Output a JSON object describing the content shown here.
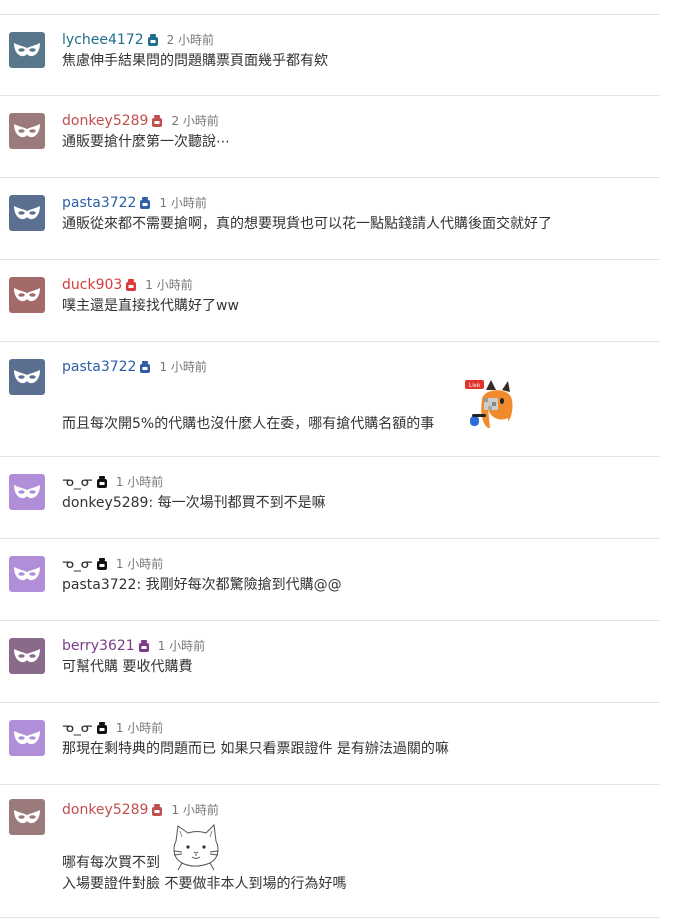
{
  "comments": [
    {
      "username": "lychee4172",
      "user_color": "#1f6f8b",
      "avatar_color": "#58778a",
      "time": "2 小時前",
      "lines": [
        "焦慮伸手結果問的問題購票頁面幾乎都有欸"
      ]
    },
    {
      "username": "donkey5289",
      "user_color": "#c0504d",
      "avatar_color": "#9a7a7a",
      "time": "2 小時前",
      "lines": [
        "通販要搶什麼第一次聽說⋯"
      ]
    },
    {
      "username": "pasta3722",
      "user_color": "#2e5fa6",
      "avatar_color": "#5b7091",
      "time": "1 小時前",
      "lines": [
        "通販從來都不需要搶啊，真的想要現貨也可以花一點點錢請人代購後面交就好了"
      ]
    },
    {
      "username": "duck903",
      "user_color": "#d93a3a",
      "avatar_color": "#a36a6a",
      "time": "1 小時前",
      "lines": [
        "噗主還是直接找代購好了ww"
      ]
    },
    {
      "username": "pasta3722",
      "user_color": "#2e5fa6",
      "avatar_color": "#5b7091",
      "time": "1 小時前",
      "lines": [
        "而且每次開5%的代購也沒什麼人在委，哪有搶代購名額的事"
      ],
      "sticker": "fox-live-sticker",
      "sticker_text": "Live"
    },
    {
      "username": "ᓀ_ᓂ",
      "user_color": "#333333",
      "avatar_color": "#b08fd8",
      "time": "1 小時前",
      "lines": [
        "donkey5289: 每一次場刊都買不到不是嘛"
      ]
    },
    {
      "username": "ᓀ_ᓂ",
      "user_color": "#333333",
      "avatar_color": "#b08fd8",
      "time": "1 小時前",
      "lines": [
        "pasta3722: 我剛好每次都驚險搶到代購@@"
      ]
    },
    {
      "username": "berry3621",
      "user_color": "#7b3b8a",
      "avatar_color": "#8a6a8a",
      "time": "1 小時前",
      "lines": [
        "可幫代購 要收代購費"
      ]
    },
    {
      "username": "ᓀ_ᓂ",
      "user_color": "#333333",
      "avatar_color": "#b08fd8",
      "time": "1 小時前",
      "lines": [
        "那現在剩特典的問題而已 如果只看票跟證件 是有辦法過關的嘛"
      ]
    },
    {
      "username": "donkey5289",
      "user_color": "#c0504d",
      "avatar_color": "#9a7a7a",
      "time": "1 小時前",
      "lines": [
        "哪有每次買不到",
        "入場要證件對臉 不要做非本人到場的行為好嗎"
      ],
      "sticker": "cat-sketch-sticker"
    }
  ]
}
